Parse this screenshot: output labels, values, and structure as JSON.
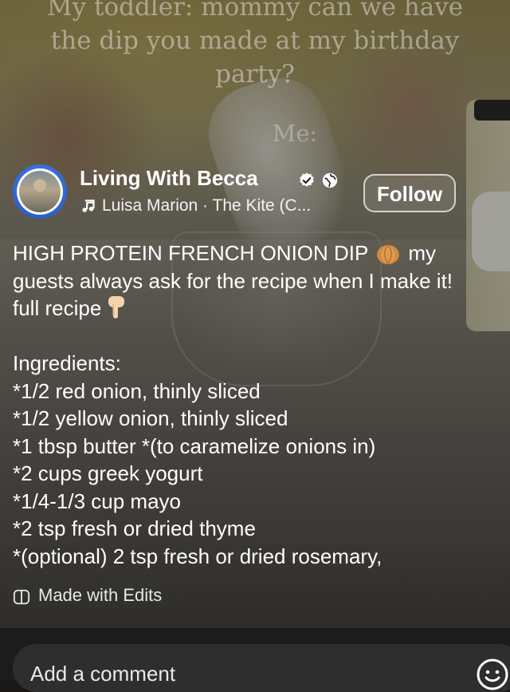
{
  "video_overlay": {
    "lines": [
      "My toddler: mommy can we have",
      "the dip you made at my birthday",
      "party?"
    ],
    "me_label": "Me:"
  },
  "author": {
    "name": "Living With Becca",
    "audio": "Luisa Marion · The Kite (C..."
  },
  "follow_label": "Follow",
  "caption_lines": [
    "HIGH PROTEIN FRENCH ONION DIP",
    "my",
    "guests always ask for the recipe when I make it!",
    "full recipe",
    "",
    "Ingredients:",
    "*1/2 red onion, thinly sliced",
    "*1/2 yellow onion, thinly sliced",
    "*1 tbsp butter *(to caramelize onions in)",
    "*2 cups greek yogurt",
    "*1/4-1/3 cup mayo",
    "*2 tsp fresh or dried thyme",
    "*(optional) 2 tsp fresh or dried rosemary,"
  ],
  "made_with": "Made with Edits",
  "comment_placeholder": "Add a comment",
  "icons": [
    "verified-icon",
    "globe-icon",
    "music-note-icon",
    "onion-emoji-icon",
    "pointing-down-icon",
    "edits-icon",
    "emoji-icon"
  ],
  "colors": {
    "avatar_ring": "#3b6fd8",
    "bottom_bar": "#1c1c1c",
    "comment_input": "#2e2e2e"
  }
}
